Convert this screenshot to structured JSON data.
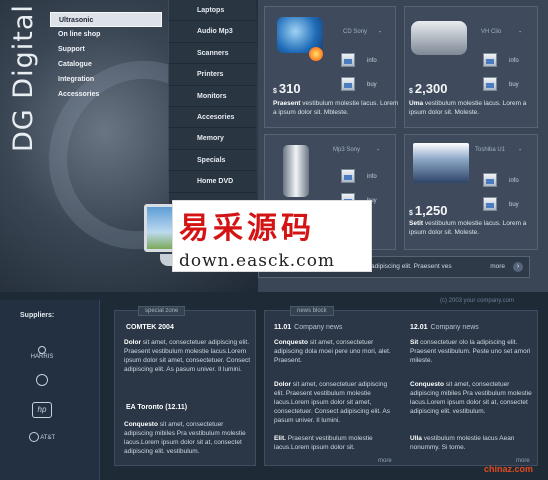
{
  "brand": {
    "name": "DG Digital"
  },
  "left_nav": [
    {
      "label": "Ultrasonic",
      "active": true
    },
    {
      "label": "On line shop"
    },
    {
      "label": "Support"
    },
    {
      "label": "Catalogue"
    },
    {
      "label": "Integration"
    },
    {
      "label": "Accessories"
    }
  ],
  "mid_nav": [
    "Laptops",
    "Audio Mp3",
    "Scanners",
    "Printers",
    "Monitors",
    "Accesories",
    "Memory",
    "Specials",
    "Home DVD"
  ],
  "products": [
    {
      "title": "CD Sony",
      "price": "310",
      "currency": "$",
      "desc_bold": "Praesent",
      "desc": "vestibulum molestie lacus. Lorem a ipsum dolor sit. Mbleste.",
      "info": "info",
      "buy": "buy",
      "icon": "cd-player-icon"
    },
    {
      "title": "VH Clio",
      "price": "2,300",
      "currency": "$",
      "desc_bold": "Uma",
      "desc": "vestibulum molestie lacus. Lorem a ipsum dolor sit. Moleste.",
      "info": "info",
      "buy": "buy",
      "icon": "camcorder-icon"
    },
    {
      "title": "Mp3 Sony",
      "price": "",
      "currency": "",
      "desc_bold": "",
      "desc": "",
      "info": "info",
      "buy": "buy",
      "icon": "mp3-player-icon"
    },
    {
      "title": "Toshiba U1",
      "price": "1,250",
      "currency": "$",
      "desc_bold": "Setit",
      "desc": "vestibulum molestie lacus. Lorem a ipsum dolor sit. Moleste.",
      "info": "info",
      "buy": "buy",
      "icon": "laptop-icon"
    }
  ],
  "promo": {
    "text": "adipiscing elit. Praesent ves",
    "more": "more"
  },
  "copyright": "(c) 2003 your company.com",
  "watermark": {
    "line1": "易采源码",
    "line2": "down.easck.com"
  },
  "suppliers": {
    "label": "Suppliers:",
    "logos": [
      "HARRIS",
      "",
      "hp",
      "AT&T"
    ]
  },
  "special_zone": {
    "tab": "special zone",
    "items": [
      {
        "title": "COMTEK 2004",
        "bold": "Dolor",
        "text": "sit amet, consectetuer adipiscing elit. Praesent vestibulum molestie lacus.Lorem ipsum dolor sit amet, consectetuer. Consect adipiscing elit. As pasum univer. Il lumini."
      },
      {
        "title": "EA Toronto (12.11)",
        "bold": "Conquesto",
        "text": "sit amet, consectetuer adipiscing mibiles Pra vestibulum molestie lacus.Lorem ipsum dolor sit at, consectet adipiscing elit. vestibulum."
      }
    ]
  },
  "news_block": {
    "tab": "news block",
    "columns": [
      {
        "date": "11.01",
        "label": "Company news",
        "items": [
          {
            "bold": "Conquesto",
            "text": "sit amet, consectetuer adipiscing dola moei pere uno mori, alet. Praesent."
          },
          {
            "bold": "Dolor",
            "text": "sit amet, consectetuer adipiscing elit. Praesent vestibulum molestie lacus.Lorem ipsum dolor sit amet, consectetuer. Consect adipiscing elit. As pasum univer. Il lumini."
          },
          {
            "bold": "Elit.",
            "text": "Praesent vestibulum molestie lacus.Lorem ipsum dolor sit."
          }
        ],
        "more": "more"
      },
      {
        "date": "12.01",
        "label": "Company news",
        "items": [
          {
            "bold": "Sit",
            "text": "consectetuer olo la adipiscing elit. Praesent vestibulum. Peste uno set amori mileste."
          },
          {
            "bold": "Conquesto",
            "text": "sit amet, consectetuer adipiscing mibiles Pra vestibulum molestie lacus.Lorem ipsum dolor sit at, consectet adipiscing elit. vestibulum."
          },
          {
            "bold": "Ulla",
            "text": "vestibulum molestie lacus Aean nonummy. Si tome."
          }
        ],
        "more": "more"
      }
    ]
  },
  "footer_brand": "chinaz.com"
}
